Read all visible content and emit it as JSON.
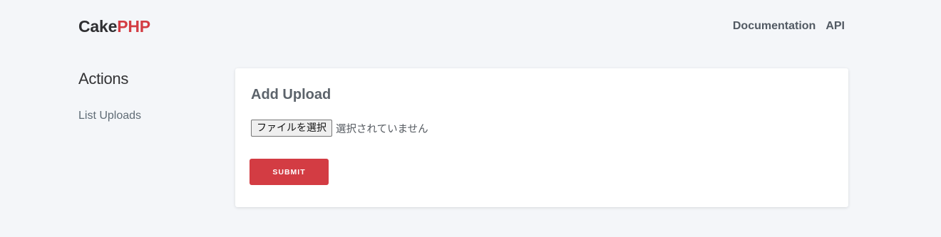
{
  "header": {
    "brand_part1": "Cake",
    "brand_part2": "PHP",
    "links": [
      "Documentation",
      "API"
    ]
  },
  "sidebar": {
    "heading": "Actions",
    "links": [
      "List Uploads"
    ]
  },
  "form": {
    "title": "Add Upload",
    "file_button_label": "ファイルを選択",
    "file_status": "選択されていません",
    "submit_label": "SUBMIT"
  },
  "colors": {
    "accent": "#d33c43",
    "background": "#f4f6f9",
    "card": "#ffffff",
    "text_dark": "#2f2f32",
    "text_muted": "#606c76"
  }
}
